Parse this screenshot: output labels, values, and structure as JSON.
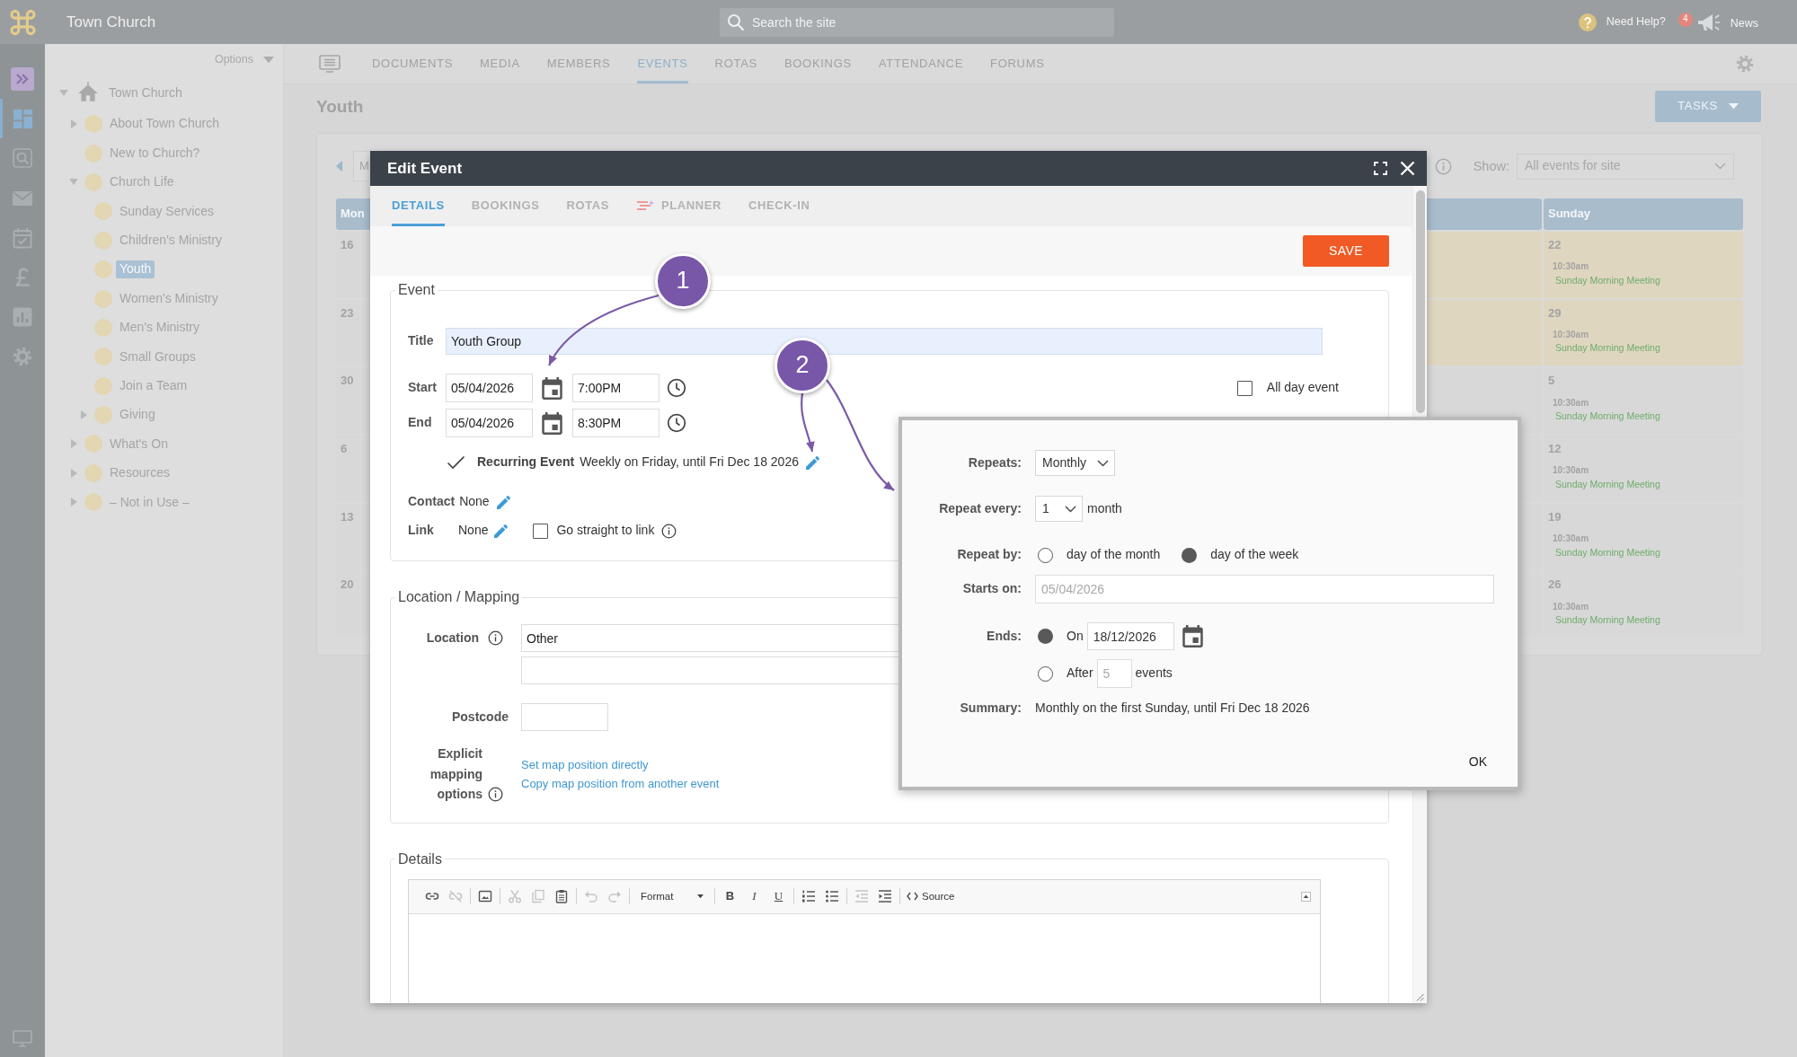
{
  "top_bar": {
    "site_name": "Town Church",
    "search": {
      "placeholder": "Search the site"
    },
    "help": "Need Help?",
    "news_count": "4",
    "news": "News"
  },
  "rail": [
    {
      "selected": false
    },
    {
      "selected": true
    },
    {
      "selected": false
    },
    {
      "selected": false
    },
    {
      "selected": false
    },
    {
      "selected": false
    },
    {
      "selected": false
    },
    {
      "selected": false
    }
  ],
  "sidebar": {
    "options": "Options",
    "tree": [
      {
        "label": "Town Church",
        "expanded": true,
        "selected": false,
        "children": [
          {
            "label": "About Town Church",
            "expanded": false,
            "selected": false
          },
          {
            "label": "New to Church?",
            "selected": false
          },
          {
            "label": "Church Life",
            "expanded": true,
            "selected": false,
            "children": [
              {
                "label": "Sunday Services",
                "selected": false
              },
              {
                "label": "Children's Ministry",
                "selected": false
              },
              {
                "label": "Youth",
                "selected": true
              },
              {
                "label": "Women's Ministry",
                "selected": false
              },
              {
                "label": "Men's Ministry",
                "selected": false
              },
              {
                "label": "Small Groups",
                "selected": false
              },
              {
                "label": "Join a Team",
                "selected": false
              },
              {
                "label": "Giving",
                "expanded": false,
                "selected": false
              }
            ]
          },
          {
            "label": "What's On",
            "expanded": false,
            "selected": false
          },
          {
            "label": "Resources",
            "expanded": false,
            "selected": false
          },
          {
            "label": "– Not in Use –",
            "expanded": false,
            "selected": false
          }
        ]
      }
    ]
  },
  "nav": {
    "tabs": [
      {
        "label": "DOCUMENTS",
        "selected": false
      },
      {
        "label": "MEDIA",
        "selected": false
      },
      {
        "label": "MEMBERS",
        "selected": false
      },
      {
        "label": "EVENTS",
        "selected": true
      },
      {
        "label": "ROTAS",
        "selected": false
      },
      {
        "label": "BOOKINGS",
        "selected": false
      },
      {
        "label": "ATTENDANCE",
        "selected": false
      },
      {
        "label": "FORUMS",
        "selected": false
      }
    ]
  },
  "page": {
    "title": "Youth",
    "tasks": "TASKS"
  },
  "calendar": {
    "month_field": "M",
    "show_label": "Show:",
    "show_value": "All events for site",
    "first_column": "Mon",
    "last_column": "Sunday",
    "weeks": [
      {
        "first_date": "16",
        "last_date": "22",
        "highlighted": true,
        "last_events": [
          {
            "time": "10:30am",
            "title": "Sunday Morning Meeting"
          }
        ]
      },
      {
        "first_date": "23",
        "last_date": "29",
        "highlighted": true,
        "last_events": [
          {
            "time": "10:30am",
            "title": "Sunday Morning Meeting"
          }
        ]
      },
      {
        "first_date": "30",
        "last_date": "5",
        "highlighted": false,
        "last_events": [
          {
            "time": "10:30am",
            "title": "Sunday Morning Meeting"
          }
        ]
      },
      {
        "first_date": "6",
        "last_date": "12",
        "highlighted": false,
        "last_events": [
          {
            "time": "10:30am",
            "title": "Sunday Morning Meeting"
          }
        ]
      },
      {
        "first_date": "13",
        "last_date": "19",
        "highlighted": false,
        "last_events": [
          {
            "time": "10:30am",
            "title": "Sunday Morning Meeting"
          }
        ]
      },
      {
        "first_date": "20",
        "last_date": "26",
        "highlighted": false,
        "last_events": [
          {
            "time": "10:30am",
            "title": "Sunday Morning Meeting"
          }
        ]
      }
    ]
  },
  "edit_event": {
    "title": "Edit Event",
    "tabs": [
      {
        "label": "DETAILS",
        "selected": true,
        "kind": "text"
      },
      {
        "label": "BOOKINGS",
        "selected": false,
        "kind": "text"
      },
      {
        "label": "ROTAS",
        "selected": false,
        "kind": "text"
      },
      {
        "label": "PLANNER",
        "selected": false,
        "kind": "icon"
      },
      {
        "label": "CHECK-IN",
        "selected": false,
        "kind": "text"
      }
    ],
    "save": "SAVE",
    "event": {
      "legend": "Event",
      "title": {
        "label": "Title",
        "value": "Youth Group"
      },
      "start": {
        "label": "Start",
        "date": "05/04/2026",
        "time": "7:00PM"
      },
      "end": {
        "label": "End",
        "date": "05/04/2026",
        "time": "8:30PM"
      },
      "all_day": {
        "label": "All day event",
        "checked": false
      },
      "recurring": {
        "label": "Recurring Event",
        "checked": true,
        "summary": "Weekly on Friday, until Fri Dec 18 2026"
      },
      "contact": {
        "label": "Contact",
        "value": "None"
      },
      "link": {
        "label": "Link",
        "value": "None"
      },
      "go_straight": {
        "label": "Go straight to link",
        "checked": false
      }
    },
    "location": {
      "legend": "Location / Mapping",
      "location": {
        "label": "Location",
        "value": "Other"
      },
      "postcode": {
        "label": "Postcode"
      },
      "mapping": {
        "label": "Explicit mapping options",
        "links": [
          "Set map position directly",
          "Copy map position from another event"
        ]
      }
    },
    "details": {
      "legend": "Details",
      "editor": {
        "buttons": [
          {
            "disabled": false
          },
          {
            "disabled": true
          },
          {
            "disabled": false
          },
          {
            "disabled": true
          },
          {
            "disabled": true
          },
          {
            "disabled": false
          },
          {
            "disabled": true
          },
          {
            "disabled": true
          },
          {
            "disabled": false
          },
          {
            "disabled": false
          },
          {
            "disabled": true
          },
          {
            "disabled": false
          }
        ],
        "format": "Format",
        "styles": [
          "B",
          "I",
          "U"
        ],
        "source": "Source"
      }
    }
  },
  "repeat_dialog": {
    "repeats": {
      "label": "Repeats:",
      "value": "Monthly"
    },
    "repeat_every": {
      "label": "Repeat every:",
      "value": "1",
      "unit": "month"
    },
    "repeat_by": {
      "label": "Repeat by:",
      "options": [
        {
          "label": "day of the month",
          "selected": false
        },
        {
          "label": "day of the week",
          "selected": true
        }
      ]
    },
    "starts_on": {
      "label": "Starts on:",
      "value": "05/04/2026",
      "disabled": true
    },
    "ends": {
      "label": "Ends:",
      "options": [
        {
          "kind": "date",
          "label": "On",
          "value": "18/12/2026",
          "selected": true,
          "disabled": false
        },
        {
          "kind": "count",
          "label": "After",
          "value": "5",
          "unit": "events",
          "selected": false,
          "disabled": true
        }
      ]
    },
    "summary": {
      "label": "Summary:",
      "value": "Monthly on the first Sunday, until Fri Dec 18 2026"
    },
    "ok": "OK"
  },
  "annotations": [
    {
      "label": "1"
    },
    {
      "label": "2"
    }
  ]
}
